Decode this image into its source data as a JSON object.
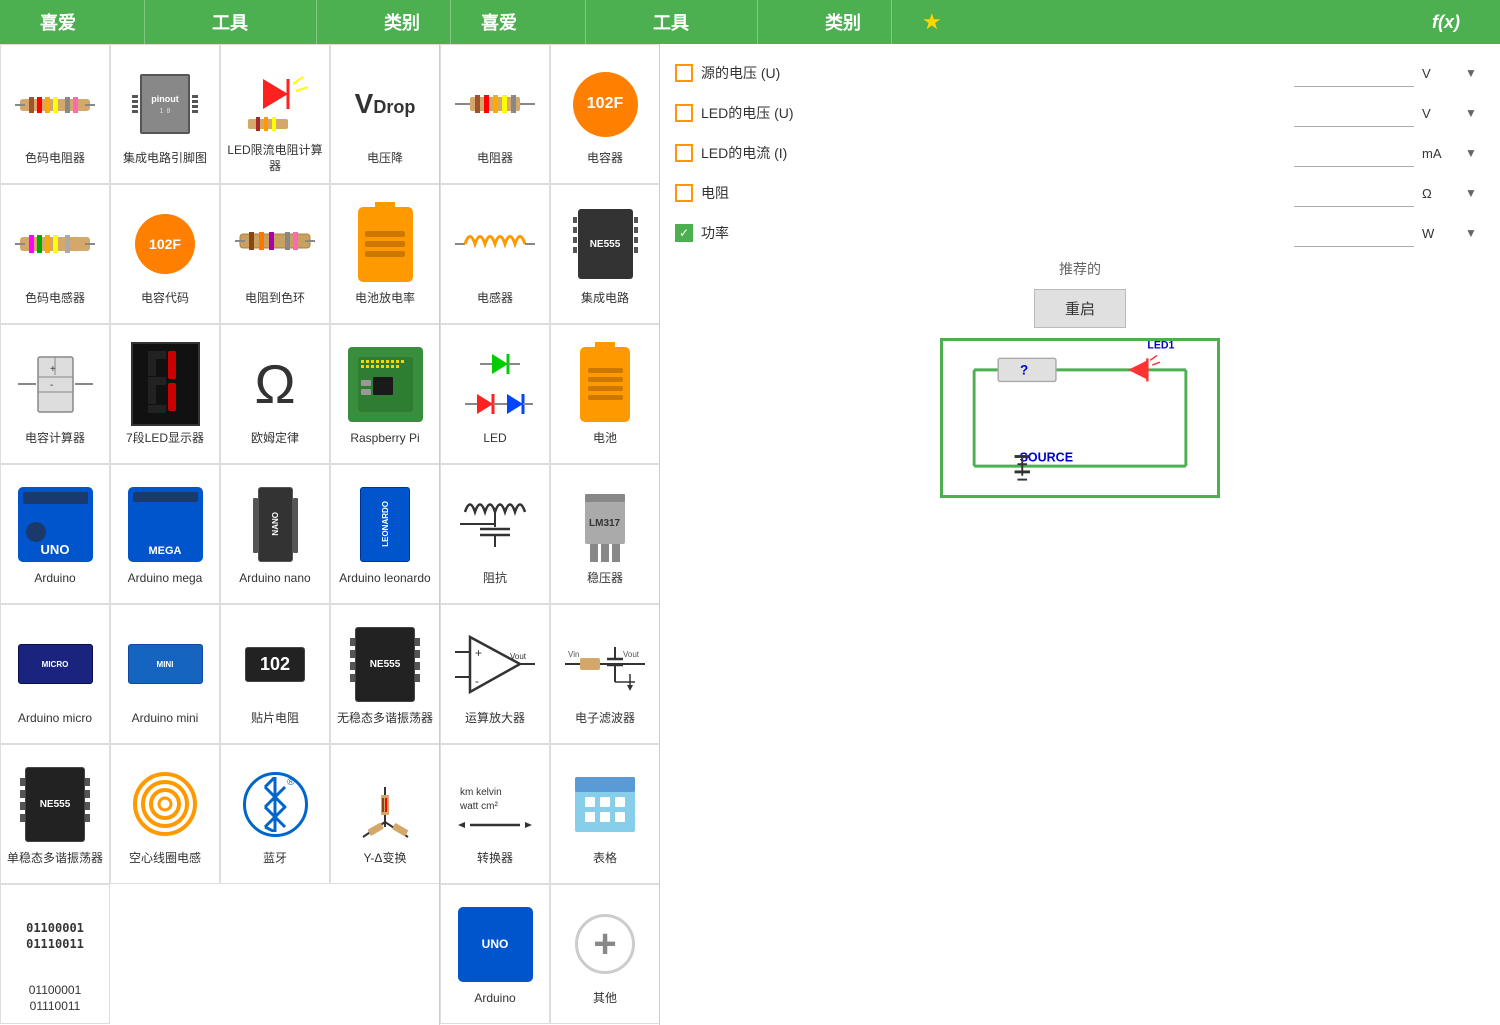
{
  "header": {
    "left_fav": "喜爱",
    "left_tools": "工具",
    "left_category": "类别",
    "right_fav": "喜爱",
    "right_tools": "工具",
    "right_category": "类别",
    "fx_label": "f(x)"
  },
  "left_tools": [
    {
      "id": "color-resistor",
      "label": "色码电阻器"
    },
    {
      "id": "ic-pinout",
      "label": "集成电路引脚图"
    },
    {
      "id": "led-resistor",
      "label": "LED限流电阻计算器"
    },
    {
      "id": "voltage-drop",
      "label": "电压降"
    },
    {
      "id": "color-inductor",
      "label": "色码电感器"
    },
    {
      "id": "capacitor-code",
      "label": "电容代码"
    },
    {
      "id": "resistor-color",
      "label": "电阻到色环"
    },
    {
      "id": "battery-rate",
      "label": "电池放电率"
    },
    {
      "id": "capacitor-calc",
      "label": "电容计算器"
    },
    {
      "id": "7seg-display",
      "label": "7段LED显示器"
    },
    {
      "id": "ohm-law",
      "label": "欧姆定律"
    },
    {
      "id": "raspberry-pi",
      "label": "Raspberry Pi"
    },
    {
      "id": "arduino-uno-tool",
      "label": "Arduino"
    },
    {
      "id": "arduino-mega-tool",
      "label": "Arduino mega"
    },
    {
      "id": "arduino-nano-tool",
      "label": "Arduino nano"
    },
    {
      "id": "arduino-leonardo-tool",
      "label": "Arduino leonardo"
    },
    {
      "id": "arduino-micro-tool",
      "label": "Arduino micro"
    },
    {
      "id": "arduino-mini-tool",
      "label": "Arduino mini"
    },
    {
      "id": "smd-resistor",
      "label": "贴片电阻"
    },
    {
      "id": "astable-multivib",
      "label": "无稳态多谐振荡器"
    },
    {
      "id": "ne555-mono",
      "label": "单稳态多谐振荡器"
    },
    {
      "id": "air-coil",
      "label": "空心线圈电感"
    },
    {
      "id": "bluetooth",
      "label": "蓝牙"
    },
    {
      "id": "y-delta",
      "label": "Y-Δ变换"
    },
    {
      "id": "binary",
      "label": "01100001\n01110011"
    }
  ],
  "middle_tools": [
    {
      "id": "resistor-mid",
      "label": "电阻器"
    },
    {
      "id": "capacitor-mid",
      "label": "电容器"
    },
    {
      "id": "inductor-mid",
      "label": "电感器"
    },
    {
      "id": "ic-mid",
      "label": "集成电路"
    },
    {
      "id": "led-mid",
      "label": "LED"
    },
    {
      "id": "battery-mid",
      "label": "电池"
    },
    {
      "id": "impedance-mid",
      "label": "阻抗"
    },
    {
      "id": "regulator-mid",
      "label": "稳压器"
    },
    {
      "id": "opamp-mid",
      "label": "运算放大器"
    },
    {
      "id": "filter-mid",
      "label": "电子滤波器"
    },
    {
      "id": "converter-mid",
      "label": "转换器"
    },
    {
      "id": "table-mid",
      "label": "表格"
    },
    {
      "id": "arduino-mid",
      "label": "Arduino"
    },
    {
      "id": "other-mid",
      "label": "其他"
    }
  ],
  "calculator": {
    "source_voltage_label": "源的电压 (U)",
    "source_voltage_unit": "V",
    "led_voltage_label": "LED的电压 (U)",
    "led_voltage_unit": "V",
    "led_current_label": "LED的电流 (I)",
    "led_current_unit": "mA",
    "resistor_label": "电阻",
    "resistor_unit": "Ω",
    "power_label": "功率",
    "power_unit": "W",
    "recommended_label": "推荐的",
    "restart_label": "重启",
    "source_checked": false,
    "led_voltage_checked": false,
    "led_current_checked": false,
    "resistor_checked": false,
    "power_checked": true
  },
  "circuit": {
    "led1_label": "LED1",
    "source_label": "SOURCE",
    "question_mark": "?"
  }
}
